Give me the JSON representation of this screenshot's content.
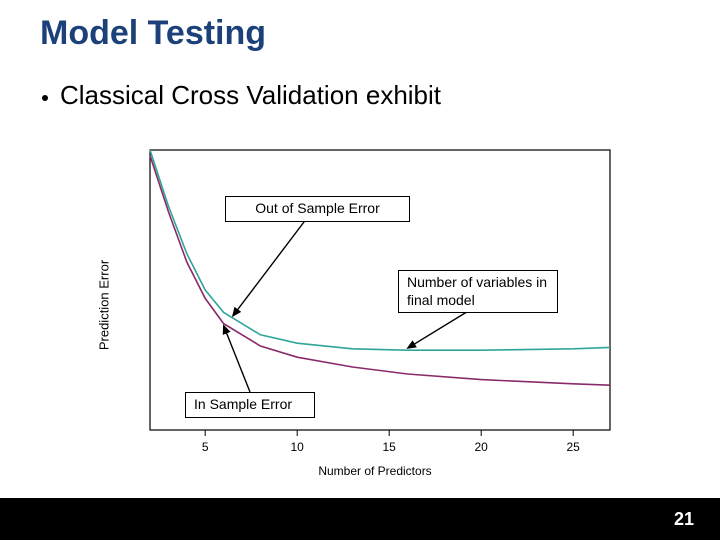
{
  "title": "Model Testing",
  "bullet": "Classical Cross Validation exhibit",
  "ylabel": "Prediction Error",
  "xlabel": "Number of Predictors",
  "callouts": {
    "out_of_sample": "Out of Sample Error",
    "num_vars": "Number of variables in final model",
    "in_sample": "In Sample Error"
  },
  "page_number": "21",
  "chart_data": {
    "type": "line",
    "title": "",
    "xlabel": "Number of Predictors",
    "ylabel": "Prediction Error",
    "xlim": [
      2,
      27
    ],
    "ylim": [
      0,
      1
    ],
    "xticks": [
      5,
      10,
      15,
      20,
      25
    ],
    "series": [
      {
        "name": "Out of Sample Error",
        "color": "#2fa59a",
        "x": [
          2,
          3,
          4,
          5,
          6,
          8,
          10,
          13,
          16,
          20,
          25,
          27
        ],
        "y": [
          1.0,
          0.8,
          0.63,
          0.5,
          0.42,
          0.34,
          0.31,
          0.29,
          0.285,
          0.285,
          0.29,
          0.295
        ]
      },
      {
        "name": "In Sample Error",
        "color": "#8a2a6b",
        "x": [
          2,
          3,
          4,
          5,
          6,
          8,
          10,
          13,
          16,
          20,
          25,
          27
        ],
        "y": [
          0.98,
          0.78,
          0.6,
          0.47,
          0.38,
          0.3,
          0.26,
          0.225,
          0.2,
          0.18,
          0.165,
          0.16
        ]
      }
    ],
    "annotations": [
      {
        "text": "Out of Sample Error",
        "arrow_to_x": 6.5,
        "arrow_to_series": "Out of Sample Error"
      },
      {
        "text": "Number of variables in final model",
        "arrow_to_x": 16,
        "arrow_to_series": "Out of Sample Error"
      },
      {
        "text": "In Sample Error",
        "arrow_to_x": 6,
        "arrow_to_series": "In Sample Error"
      }
    ]
  }
}
